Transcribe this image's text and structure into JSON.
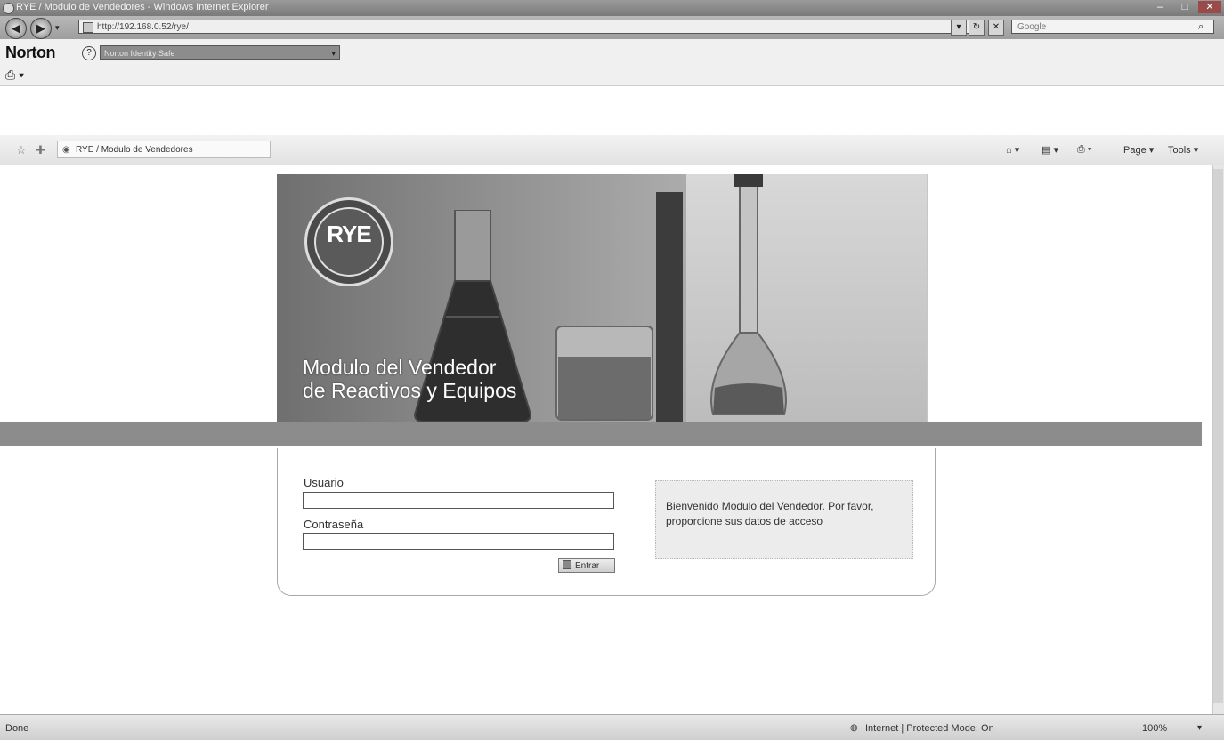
{
  "window": {
    "title": "RYE / Modulo de Vendedores - Windows Internet Explorer",
    "minimize": "–",
    "maximize": "□",
    "close": "✕"
  },
  "address_bar": {
    "url": "http://192.168.0.52/rye/",
    "back_icon": "back-arrow-icon",
    "forward_icon": "forward-arrow-icon",
    "search_placeholder": "Google",
    "refresh": "↻",
    "stop": "✕",
    "search_icon": "⌕"
  },
  "norton": {
    "logo": "Norton",
    "help": "?",
    "dropdown_value": "Norton Identity Safe",
    "dropdown_arrow": "▾"
  },
  "command_bar": {
    "tab_title": "RYE / Modulo de Vendedores",
    "page_menu": "Page ▾",
    "tools_menu": "Tools ▾",
    "home_icon": "⌂ ▾",
    "feeds_icon": "▤ ▾",
    "print_icon": "⎙ ▾"
  },
  "banner": {
    "logo_text": "RYE",
    "title_line1": "Modulo del Vendedor",
    "title_line2": "de Reactivos y Equipos"
  },
  "login": {
    "user_label": "Usuario",
    "user_value": "",
    "password_label": "Contraseña",
    "password_value": "",
    "submit_label": "Entrar",
    "welcome_text": "Bienvenido Modulo del Vendedor. Por favor, proporcione sus datos de acceso"
  },
  "status_bar": {
    "status": "Done",
    "zone": "Internet | Protected Mode: On",
    "zoom": "100%",
    "zoom_arrow": "▾"
  },
  "colors": {
    "banner_stripe": "#8c8c8c",
    "title_bar": "#8a8a8a"
  }
}
